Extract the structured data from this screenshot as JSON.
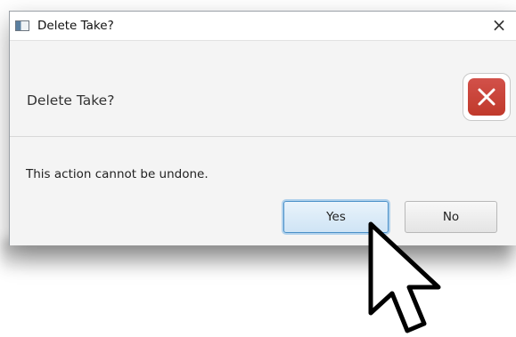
{
  "window": {
    "title": "Delete Take?",
    "close_glyph": "×"
  },
  "header": {
    "text": "Delete Take?",
    "icon": "error-icon"
  },
  "content": {
    "message": "This action cannot be undone."
  },
  "buttons": {
    "yes_label": "Yes",
    "no_label": "No"
  },
  "colors": {
    "error_red": "#c9443c",
    "default_button_border": "#4a90c8",
    "pane_background": "#f4f4f4"
  }
}
